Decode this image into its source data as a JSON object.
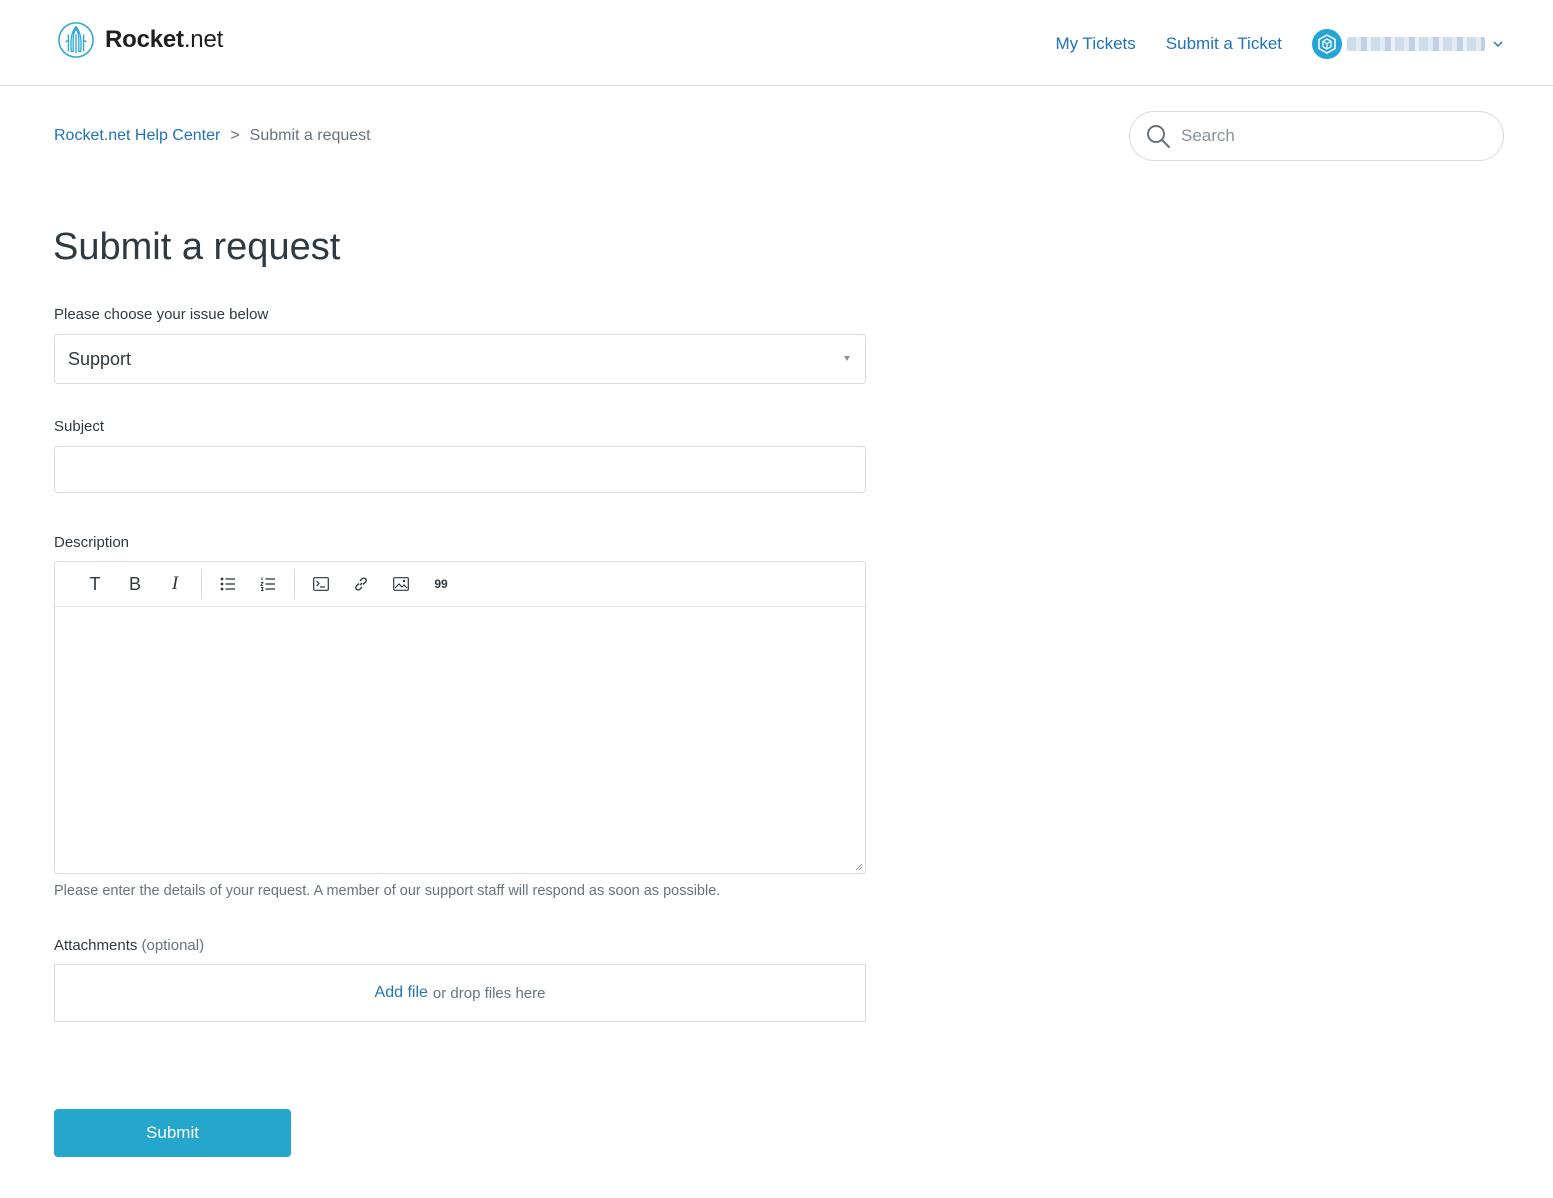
{
  "header": {
    "logo": {
      "bold": "Rocket",
      "thin": ".net",
      "icon": "rocket-logo-icon"
    },
    "nav": [
      {
        "label": "My Tickets"
      },
      {
        "label": "Submit a Ticket"
      }
    ],
    "user": {
      "avatar_icon": "cube-hexagon-icon",
      "name": "[redacted]",
      "menu_icon": "chevron-down-icon"
    }
  },
  "breadcrumb": {
    "items": [
      {
        "label": "Rocket.net Help Center"
      },
      {
        "label": "Submit a request"
      }
    ],
    "separator": ">"
  },
  "search": {
    "placeholder": "Search",
    "value": "",
    "icon": "search-icon"
  },
  "page": {
    "title": "Submit a request"
  },
  "form": {
    "issue": {
      "label": "Please choose your issue below",
      "selected": "Support"
    },
    "subject": {
      "label": "Subject",
      "value": ""
    },
    "description": {
      "label": "Description",
      "toolbar": [
        {
          "name": "text-format",
          "glyph": "T"
        },
        {
          "name": "bold",
          "glyph": "B"
        },
        {
          "name": "italic",
          "glyph": "I"
        },
        {
          "name": "bulleted-list"
        },
        {
          "name": "numbered-list"
        },
        {
          "name": "code-block"
        },
        {
          "name": "link"
        },
        {
          "name": "image"
        },
        {
          "name": "quote",
          "glyph": "99"
        }
      ],
      "value": "",
      "hint": "Please enter the details of your request. A member of our support staff will respond as soon as possible."
    },
    "attachments": {
      "label": "Attachments",
      "optional": "(optional)",
      "add_file": "Add file",
      "drop_text": "or drop files here"
    },
    "submit_label": "Submit"
  },
  "colors": {
    "link": "#1f73b7",
    "submit": "#25a6cd",
    "text": "#2f3941",
    "muted": "#68737d"
  }
}
